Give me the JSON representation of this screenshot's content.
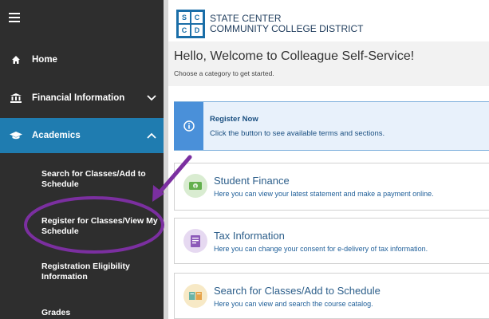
{
  "sidebar": {
    "items": [
      {
        "label": "Home",
        "icon": "home-icon"
      },
      {
        "label": "Financial Information",
        "icon": "bank-icon"
      },
      {
        "label": "Academics",
        "icon": "graduation-cap-icon"
      }
    ],
    "subitems": [
      {
        "label": "Search for Classes/Add to Schedule"
      },
      {
        "label": "Register for Classes/View My Schedule"
      },
      {
        "label": "Registration Eligibility Information"
      },
      {
        "label": "Grades"
      }
    ],
    "active_color": "#1f7cb0",
    "bg_color": "#2e2e2e"
  },
  "logo": {
    "letters": [
      "S",
      "C",
      "C",
      "D"
    ],
    "line1": "STATE CENTER",
    "line2": "COMMUNITY COLLEGE DISTRICT"
  },
  "header": {
    "title": "Hello, Welcome to Colleague Self-Service!",
    "subtitle": "Choose a category to get started."
  },
  "register_card": {
    "title": "Register Now",
    "description": "Click the button to see available terms and sections."
  },
  "cards": [
    {
      "title": "Student Finance",
      "description": "Here you can view your latest statement and make a payment online.",
      "icon": "money-icon"
    },
    {
      "title": "Tax Information",
      "description": "Here you can change your consent for e-delivery of tax information.",
      "icon": "tax-document-icon"
    },
    {
      "title": "Search for Classes/Add to Schedule",
      "description": "Here you can view and search the course catalog.",
      "icon": "course-catalog-icon"
    }
  ],
  "annotation": {
    "color": "#7b2fa0",
    "marks": [
      "purple-arrow",
      "purple-ellipse"
    ]
  }
}
